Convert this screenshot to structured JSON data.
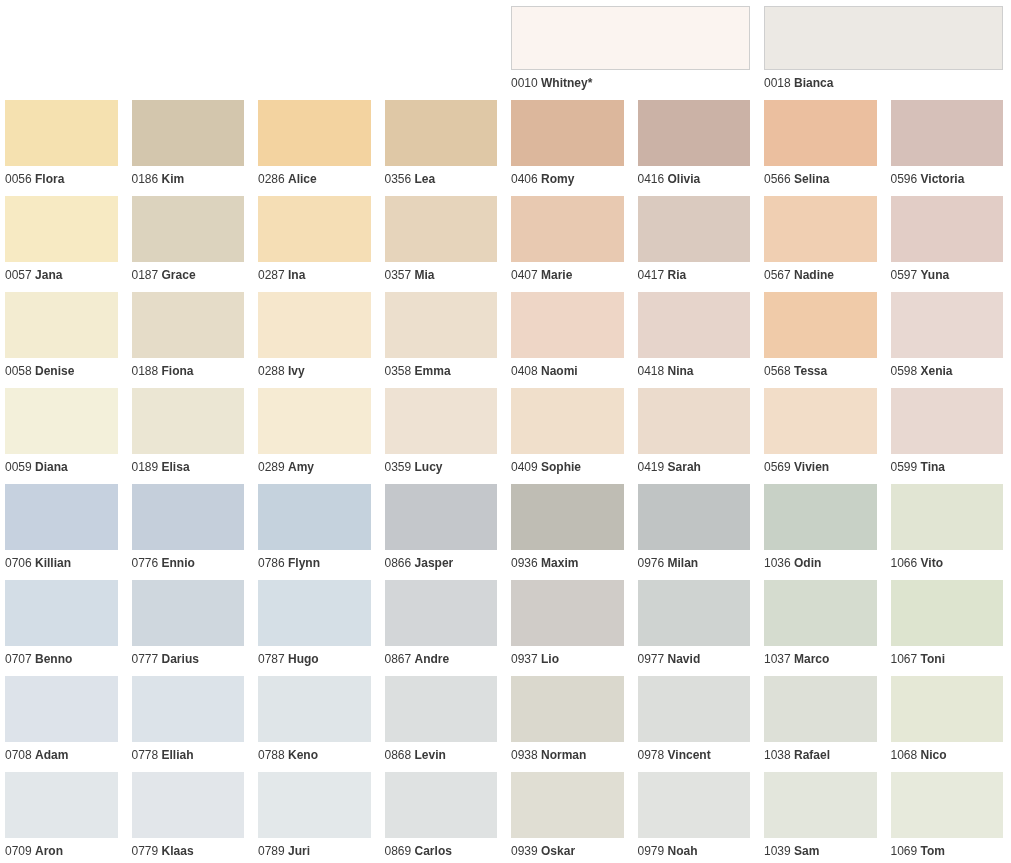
{
  "featured": [
    {
      "code": "0010",
      "name": "Whitney*",
      "color": "#fbf4f0"
    },
    {
      "code": "0018",
      "name": "Bianca",
      "color": "#ece9e4"
    }
  ],
  "swatches": [
    {
      "code": "0056",
      "name": "Flora",
      "color": "#f5e1b0"
    },
    {
      "code": "0186",
      "name": "Kim",
      "color": "#d3c6ad"
    },
    {
      "code": "0286",
      "name": "Alice",
      "color": "#f3d3a0"
    },
    {
      "code": "0356",
      "name": "Lea",
      "color": "#dfc8a6"
    },
    {
      "code": "0406",
      "name": "Romy",
      "color": "#dcb79c"
    },
    {
      "code": "0416",
      "name": "Olivia",
      "color": "#cbb2a6"
    },
    {
      "code": "0566",
      "name": "Selina",
      "color": "#ebbf9f"
    },
    {
      "code": "0596",
      "name": "Victoria",
      "color": "#d6c0b9"
    },
    {
      "code": "0057",
      "name": "Jana",
      "color": "#f7eac3"
    },
    {
      "code": "0187",
      "name": "Grace",
      "color": "#dcd3be"
    },
    {
      "code": "0287",
      "name": "Ina",
      "color": "#f5deb5"
    },
    {
      "code": "0357",
      "name": "Mia",
      "color": "#e6d4bb"
    },
    {
      "code": "0407",
      "name": "Marie",
      "color": "#e8c9b1"
    },
    {
      "code": "0417",
      "name": "Ria",
      "color": "#dacabf"
    },
    {
      "code": "0567",
      "name": "Nadine",
      "color": "#f0cfb2"
    },
    {
      "code": "0597",
      "name": "Yuna",
      "color": "#e2cdc6"
    },
    {
      "code": "0058",
      "name": "Denise",
      "color": "#f3ecd1"
    },
    {
      "code": "0188",
      "name": "Fiona",
      "color": "#e5dcc8"
    },
    {
      "code": "0288",
      "name": "Ivy",
      "color": "#f6e7cc"
    },
    {
      "code": "0358",
      "name": "Emma",
      "color": "#ecdfcd"
    },
    {
      "code": "0408",
      "name": "Naomi",
      "color": "#eed6c6"
    },
    {
      "code": "0418",
      "name": "Nina",
      "color": "#e6d4cb"
    },
    {
      "code": "0568",
      "name": "Tessa",
      "color": "#f0cba9"
    },
    {
      "code": "0598",
      "name": "Xenia",
      "color": "#e8d8d2"
    },
    {
      "code": "0059",
      "name": "Diana",
      "color": "#f3f0da"
    },
    {
      "code": "0189",
      "name": "Elisa",
      "color": "#ebe6d3"
    },
    {
      "code": "0289",
      "name": "Amy",
      "color": "#f6ebd3"
    },
    {
      "code": "0359",
      "name": "Lucy",
      "color": "#eee2d3"
    },
    {
      "code": "0409",
      "name": "Sophie",
      "color": "#f0dfcb"
    },
    {
      "code": "0419",
      "name": "Sarah",
      "color": "#ebdbcc"
    },
    {
      "code": "0569",
      "name": "Vivien",
      "color": "#f2ddc8"
    },
    {
      "code": "0599",
      "name": "Tina",
      "color": "#e8d8d1"
    },
    {
      "code": "0706",
      "name": "Killian",
      "color": "#c6d1df"
    },
    {
      "code": "0776",
      "name": "Ennio",
      "color": "#c5cfdb"
    },
    {
      "code": "0786",
      "name": "Flynn",
      "color": "#c5d2dd"
    },
    {
      "code": "0866",
      "name": "Jasper",
      "color": "#c4c7cb"
    },
    {
      "code": "0936",
      "name": "Maxim",
      "color": "#bfbdb4"
    },
    {
      "code": "0976",
      "name": "Milan",
      "color": "#c0c4c4"
    },
    {
      "code": "1036",
      "name": "Odin",
      "color": "#c8d1c6"
    },
    {
      "code": "1066",
      "name": "Vito",
      "color": "#e1e5d3"
    },
    {
      "code": "0707",
      "name": "Benno",
      "color": "#d3dde6"
    },
    {
      "code": "0777",
      "name": "Darius",
      "color": "#cfd7de"
    },
    {
      "code": "0787",
      "name": "Hugo",
      "color": "#d5dfe6"
    },
    {
      "code": "0867",
      "name": "Andre",
      "color": "#d3d6d8"
    },
    {
      "code": "0937",
      "name": "Lio",
      "color": "#d0ccc8"
    },
    {
      "code": "0977",
      "name": "Navid",
      "color": "#cfd3d1"
    },
    {
      "code": "1037",
      "name": "Marco",
      "color": "#d5dccf"
    },
    {
      "code": "1067",
      "name": "Toni",
      "color": "#dde4cf"
    },
    {
      "code": "0708",
      "name": "Adam",
      "color": "#dde3ea"
    },
    {
      "code": "0778",
      "name": "Elliah",
      "color": "#dce3e9"
    },
    {
      "code": "0788",
      "name": "Keno",
      "color": "#dfe5e8"
    },
    {
      "code": "0868",
      "name": "Levin",
      "color": "#dcdfdf"
    },
    {
      "code": "0938",
      "name": "Norman",
      "color": "#dad8cd"
    },
    {
      "code": "0978",
      "name": "Vincent",
      "color": "#dcdedb"
    },
    {
      "code": "1038",
      "name": "Rafael",
      "color": "#dde0d7"
    },
    {
      "code": "1068",
      "name": "Nico",
      "color": "#e5e8d6"
    },
    {
      "code": "0709",
      "name": "Aron",
      "color": "#e2e7ea"
    },
    {
      "code": "0779",
      "name": "Klaas",
      "color": "#e2e6ea"
    },
    {
      "code": "0789",
      "name": "Juri",
      "color": "#e3e8ea"
    },
    {
      "code": "0869",
      "name": "Carlos",
      "color": "#dfe2e2"
    },
    {
      "code": "0939",
      "name": "Oskar",
      "color": "#e0ded3"
    },
    {
      "code": "0979",
      "name": "Noah",
      "color": "#e1e3e0"
    },
    {
      "code": "1039",
      "name": "Sam",
      "color": "#e3e6dc"
    },
    {
      "code": "1069",
      "name": "Tom",
      "color": "#e7eadc"
    }
  ]
}
